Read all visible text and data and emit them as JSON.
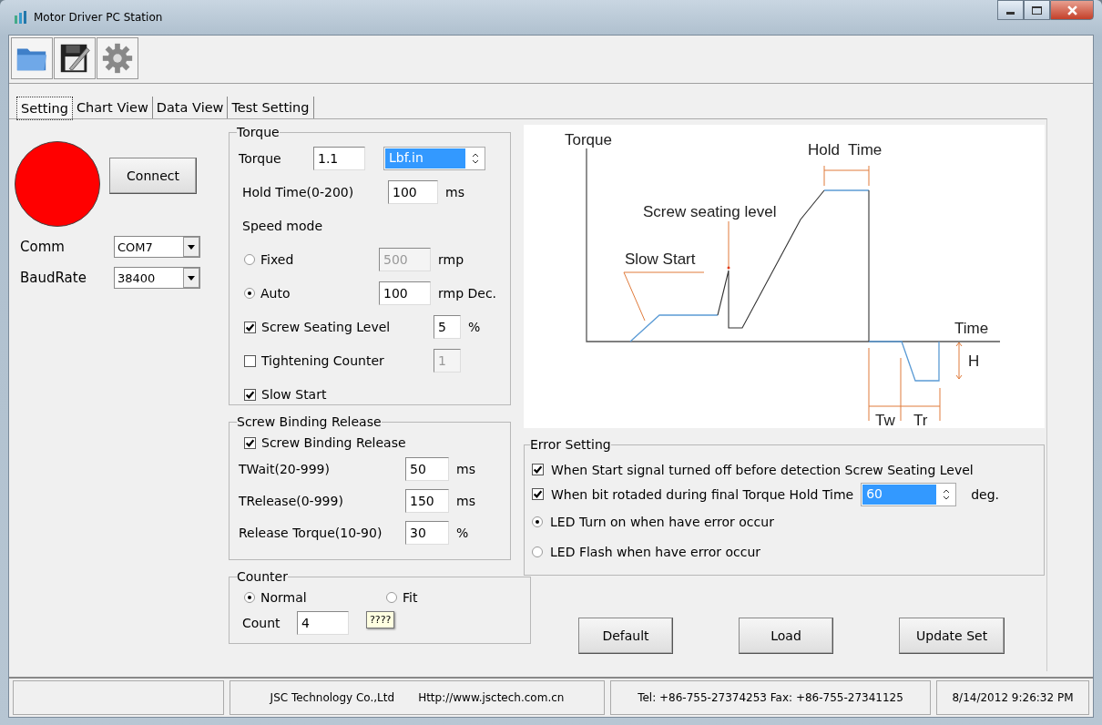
{
  "window": {
    "title": "Motor Driver PC Station"
  },
  "tabs": [
    {
      "label": "Setting",
      "selected": true
    },
    {
      "label": "Chart View",
      "selected": false
    },
    {
      "label": "Data View",
      "selected": false
    },
    {
      "label": "Test Setting",
      "selected": false
    }
  ],
  "connection": {
    "connected": false,
    "button": "Connect",
    "comm": {
      "label": "Comm",
      "value": "COM7"
    },
    "baud": {
      "label": "BaudRate",
      "value": "38400"
    }
  },
  "torque_group": {
    "title": "Torque",
    "torque": {
      "label": "Torque",
      "value": "1.1",
      "unit": "Lbf.in"
    },
    "hold_time": {
      "label": "Hold Time(0-200)",
      "value": "100",
      "unit": "ms"
    },
    "speed_mode": {
      "label": "Speed mode",
      "options": [
        {
          "label": "Fixed",
          "selected": false,
          "value": "500",
          "unit": "rmp",
          "disabled": true
        },
        {
          "label": "Auto",
          "selected": true,
          "value": "100",
          "unit": "rmp Dec.",
          "disabled": false
        }
      ]
    },
    "checks": [
      {
        "label": "Screw Seating Level",
        "checked": true,
        "value": "5",
        "unit": "%",
        "disabled": false
      },
      {
        "label": "Tightening Counter",
        "checked": false,
        "value": "1",
        "disabled": true
      },
      {
        "label": "Slow Start",
        "checked": true
      }
    ]
  },
  "binding_group": {
    "title": "Screw Binding Release",
    "check": {
      "label": "Screw Binding Release",
      "checked": true
    },
    "fields": [
      {
        "label": "TWait(20-999)",
        "value": "50",
        "unit": "ms"
      },
      {
        "label": "TRelease(0-999)",
        "value": "150",
        "unit": "ms"
      },
      {
        "label": "Release Torque(10-90)",
        "value": "30",
        "unit": "%"
      }
    ]
  },
  "counter_group": {
    "title": "Counter",
    "modes": [
      {
        "label": "Normal",
        "selected": true
      },
      {
        "label": "Fit",
        "selected": false
      }
    ],
    "tooltip": "????",
    "count": {
      "label": "Count",
      "value": "4"
    }
  },
  "diagram": {
    "torque_axis": "Torque",
    "time_axis": "Time",
    "hold_time": "Hold  Time",
    "seating_level": "Screw seating level",
    "slow_start": "Slow Start",
    "tw": "Tw",
    "tr": "Tr",
    "h": "H"
  },
  "error_group": {
    "title": "Error Setting",
    "items": [
      {
        "kind": "check",
        "label": "When Start signal turned off before detection Screw Seating Level",
        "checked": true
      },
      {
        "kind": "check_spin",
        "label": "When bit rotaded during final Torque Hold Time",
        "checked": true,
        "value": "60",
        "unit": "deg."
      },
      {
        "kind": "radio",
        "label": "LED Turn on when have error occur",
        "selected": true
      },
      {
        "kind": "radio",
        "label": "LED Flash when have error occur",
        "selected": false
      }
    ]
  },
  "buttons": [
    "Default",
    "Load",
    "Update Set"
  ],
  "status_bar": {
    "company": "JSC Technology Co.,Ltd",
    "website": "Http://www.jsctech.com.cn",
    "contact": "Tel: +86-755-27374253  Fax: +86-755-27341125",
    "datetime": "8/14/2012 9:26:32 PM"
  }
}
